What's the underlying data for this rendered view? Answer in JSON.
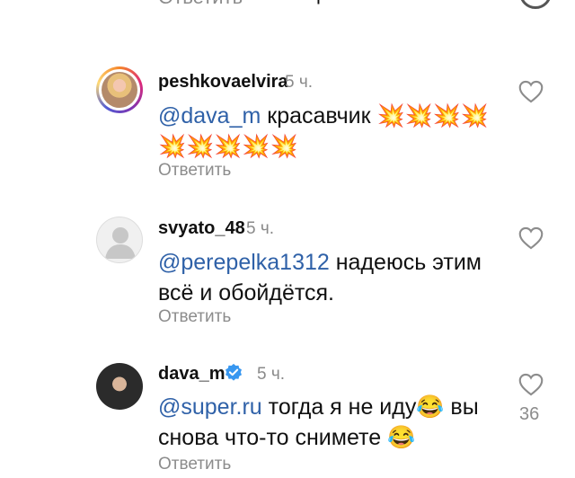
{
  "top": {
    "reply_label": "Ответить",
    "cut_char": "р"
  },
  "comments": [
    {
      "username": "peshkovaelvira",
      "time": "5 ч.",
      "mention": "@dava_m",
      "text": " красавчик 💥💥💥💥💥💥💥💥💥",
      "reply_label": "Ответить"
    },
    {
      "username": "svyato_48",
      "time": "5 ч.",
      "mention": "@perepelka1312",
      "text": " надеюсь этим всё и обойдётся.",
      "reply_label": "Ответить"
    },
    {
      "username": "dava_m",
      "time": "5 ч.",
      "mention": "@super.ru",
      "text": " тогда я не иду😂 вы снова что-то снимете 😂",
      "reply_label": "Ответить",
      "likes": "36",
      "verified": true
    }
  ],
  "colors": {
    "mention": "#2f61a8",
    "verified": "#3897f0",
    "muted": "#8c8c8c"
  }
}
